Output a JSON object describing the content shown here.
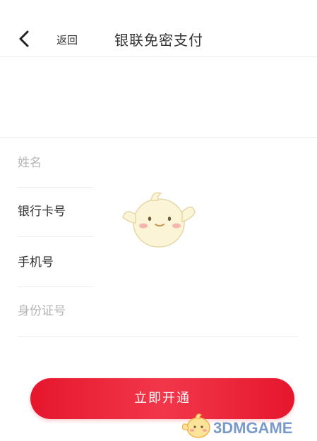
{
  "header": {
    "back_label": "返回",
    "title": "银联免密支付"
  },
  "form": {
    "name_placeholder": "姓名",
    "card_number_label": "银行卡号",
    "phone_label": "手机号",
    "id_placeholder": "身份证号"
  },
  "actions": {
    "submit_label": "立即开通"
  },
  "watermark": {
    "text": "3DMGAME"
  },
  "colors": {
    "accent": "#e5162d",
    "placeholder": "#b5b5b5",
    "text": "#333333",
    "divider": "#ececec"
  },
  "icons": {
    "back": "chevron-left-icon",
    "mascot": "mascot-icon"
  }
}
